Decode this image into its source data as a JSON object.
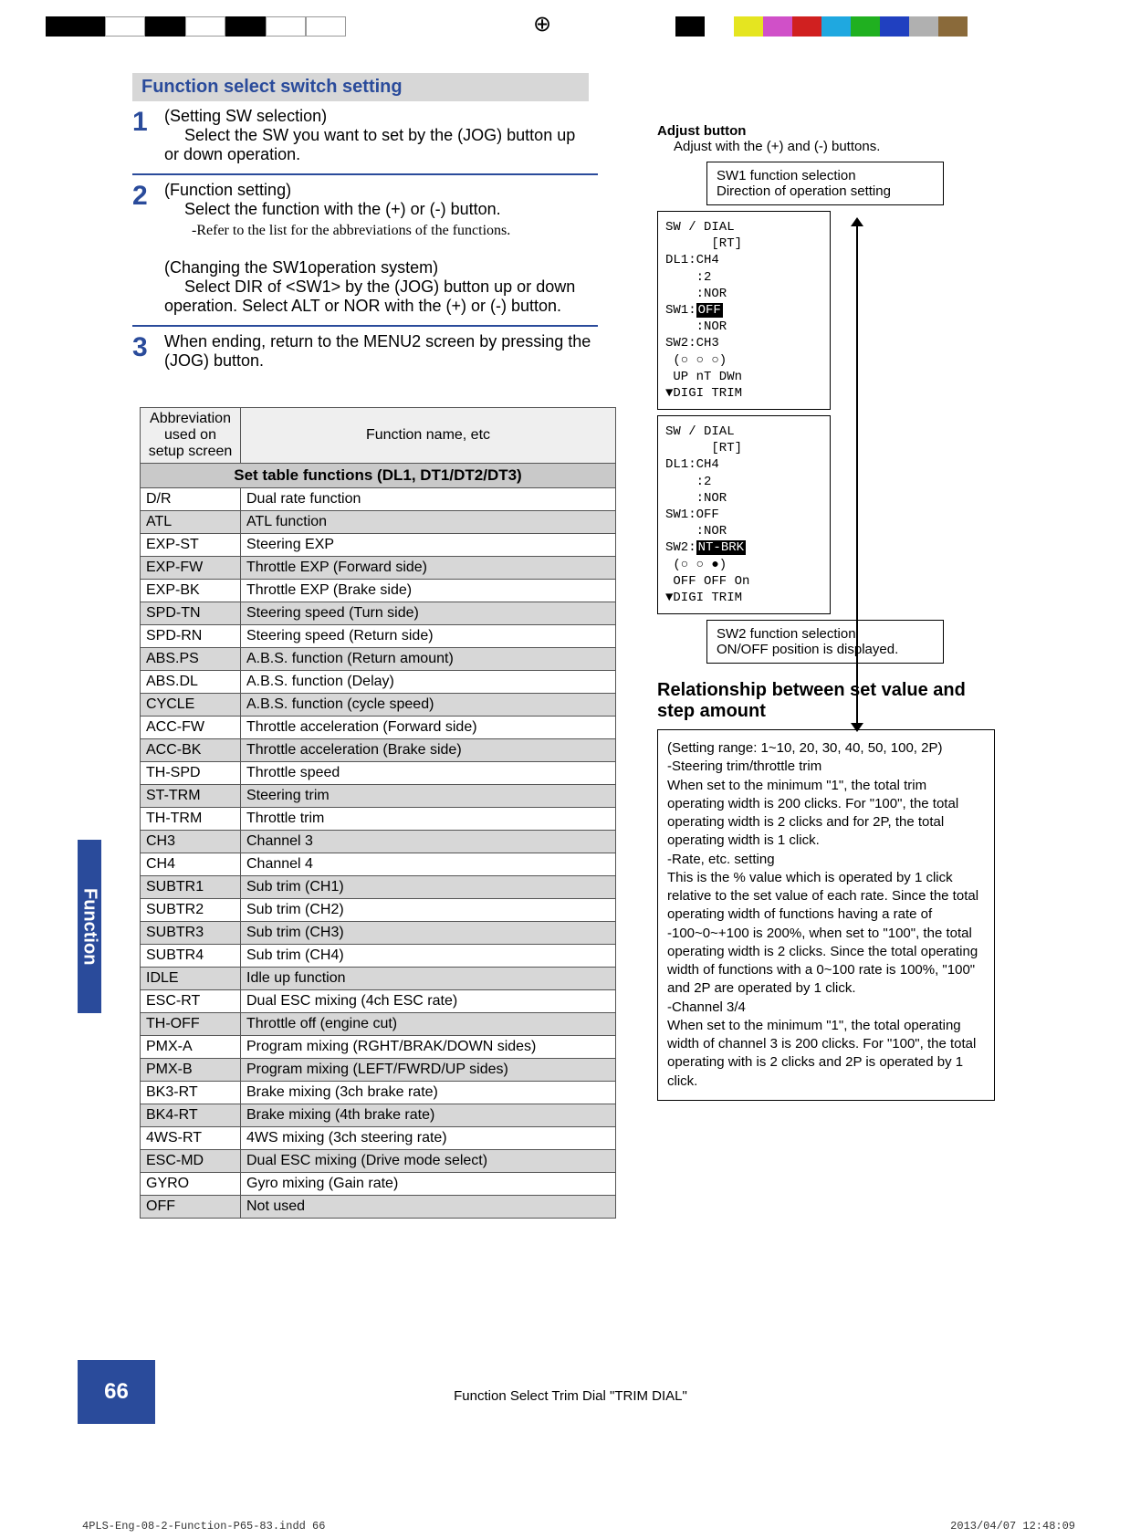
{
  "topbar_colors": [
    "#000",
    "#fff",
    "#e5e520",
    "#d050c8",
    "#d02020",
    "#1fa8e0",
    "#20b020",
    "#2040c0",
    "#b0b0b0",
    "#8a6a3a"
  ],
  "section_heading": "Function select switch setting",
  "steps": [
    {
      "num": "1",
      "title": "(Setting SW selection)",
      "body": "Select the SW you want to set by the (JOG) button up or down operation."
    },
    {
      "num": "2",
      "title": "(Function setting)",
      "body": "Select the function with the (+) or (-) button.",
      "refer": "-Refer to the list for the abbreviations of the functions.",
      "title2": "(Changing the SW1operation system)",
      "body2": "Select DIR of <SW1> by the (JOG) button up or down operation. Select ALT or NOR with the (+) or (-) button."
    },
    {
      "num": "3",
      "body": "When ending, return to the MENU2 screen by pressing the (JOG) button."
    }
  ],
  "table": {
    "title": "Set table functions (DL1, DT1/DT2/DT3)",
    "col1": "Abbreviation used on setup screen",
    "col2": "Function name, etc",
    "rows": [
      {
        "abbr": "D/R",
        "name": "Dual rate function",
        "shade": false
      },
      {
        "abbr": "ATL",
        "name": "ATL function",
        "shade": true
      },
      {
        "abbr": "EXP-ST",
        "name": "Steering EXP",
        "shade": false
      },
      {
        "abbr": "EXP-FW",
        "name": "Throttle EXP (Forward side)",
        "shade": true
      },
      {
        "abbr": "EXP-BK",
        "name": "Throttle EXP (Brake side)",
        "shade": false
      },
      {
        "abbr": "SPD-TN",
        "name": "Steering speed (Turn side)",
        "shade": true
      },
      {
        "abbr": "SPD-RN",
        "name": "Steering speed (Return side)",
        "shade": false
      },
      {
        "abbr": "ABS.PS",
        "name": "A.B.S. function (Return amount)",
        "shade": true
      },
      {
        "abbr": "ABS.DL",
        "name": "A.B.S. function (Delay)",
        "shade": false
      },
      {
        "abbr": "CYCLE",
        "name": "A.B.S. function (cycle speed)",
        "shade": true
      },
      {
        "abbr": "ACC-FW",
        "name": "Throttle acceleration (Forward side)",
        "shade": false
      },
      {
        "abbr": "ACC-BK",
        "name": "Throttle acceleration (Brake side)",
        "shade": true
      },
      {
        "abbr": "TH-SPD",
        "name": "Throttle speed",
        "shade": false
      },
      {
        "abbr": "ST-TRM",
        "name": "Steering trim",
        "shade": true
      },
      {
        "abbr": "TH-TRM",
        "name": "Throttle trim",
        "shade": false
      },
      {
        "abbr": "CH3",
        "name": "Channel 3",
        "shade": true
      },
      {
        "abbr": "CH4",
        "name": "Channel 4",
        "shade": false
      },
      {
        "abbr": "SUBTR1",
        "name": "Sub trim (CH1)",
        "shade": true
      },
      {
        "abbr": "SUBTR2",
        "name": "Sub trim (CH2)",
        "shade": false
      },
      {
        "abbr": "SUBTR3",
        "name": "Sub trim (CH3)",
        "shade": true
      },
      {
        "abbr": "SUBTR4",
        "name": "Sub trim (CH4)",
        "shade": false
      },
      {
        "abbr": "IDLE",
        "name": "Idle up function",
        "shade": true
      },
      {
        "abbr": "ESC-RT",
        "name": "Dual ESC mixing (4ch ESC rate)",
        "shade": false
      },
      {
        "abbr": "TH-OFF",
        "name": "Throttle off (engine cut)",
        "shade": true
      },
      {
        "abbr": "PMX-A",
        "name": "Program mixing      (RGHT/BRAK/DOWN sides)",
        "shade": false
      },
      {
        "abbr": "PMX-B",
        "name": "Program mixing      (LEFT/FWRD/UP sides)",
        "shade": true
      },
      {
        "abbr": "BK3-RT",
        "name": "Brake mixing (3ch brake rate)",
        "shade": false
      },
      {
        "abbr": "BK4-RT",
        "name": "Brake mixing (4th brake rate)",
        "shade": true
      },
      {
        "abbr": "4WS-RT",
        "name": "4WS mixing (3ch steering rate)",
        "shade": false
      },
      {
        "abbr": "ESC-MD",
        "name": "Dual ESC mixing (Drive mode select)",
        "shade": true
      },
      {
        "abbr": "GYRO",
        "name": "Gyro mixing (Gain rate)",
        "shade": false
      },
      {
        "abbr": "OFF",
        "name": "Not used",
        "shade": true
      }
    ]
  },
  "right": {
    "adjust_title": "Adjust button",
    "adjust_text": "Adjust with the (+) and (-) buttons.",
    "sw1_l1": "SW1 function selection",
    "sw1_l2": "Direction of operation setting",
    "sw2_l1": "SW2 function selection",
    "sw2_l2": "ON/OFF position is displayed.",
    "lcd1": "SW / DIAL\n      [RT]\nDL1:CH4\n    :2\n    :NOR\nSW1:OFF\n    :NOR\nSW2:CH3\n (○ ○ ○)\n UP nT DWn\n\n▼DIGI TRIM",
    "lcd2": "SW / DIAL\n      [RT]\nDL1:CH4\n    :2\n    :NOR\nSW1:OFF\n    :NOR\nSW2:NT-BRK\n (○ ○ ●)\n OFF OFF On\n\n▼DIGI TRIM",
    "rel_heading": "Relationship between set value and step amount",
    "rel_p1": "(Setting range: 1~10, 20, 30, 40, 50, 100, 2P)",
    "rel_p2": "-Steering trim/throttle trim",
    "rel_p3": "When set to the minimum \"1\", the total trim operating width is 200 clicks. For \"100\", the total operating width is 2 clicks and for 2P, the total operating width is 1 click.",
    "rel_p4": "-Rate, etc. setting",
    "rel_p5": "This is the % value which is operated by 1 click relative to the set value of each rate. Since the total operating width of functions having a rate of -100~0~+100 is 200%, when set to \"100\", the total operating width is 2 clicks. Since the total operating width of functions with a 0~100 rate is 100%, \"100\" and 2P are operated by 1 click.",
    "rel_p6": "-Channel 3/4",
    "rel_p7": "When set to the minimum \"1\", the total operating width of channel 3 is 200 clicks. For \"100\", the total operating with is 2 clicks and 2P is operated by 1 click."
  },
  "footer": "Function Select Trim Dial  \"TRIM DIAL\"",
  "pagenum": "66",
  "sidelabel": "Function",
  "imprint_left": "4PLS-Eng-08-2-Function-P65-83.indd   66",
  "imprint_right": "2013/04/07   12:48:09"
}
